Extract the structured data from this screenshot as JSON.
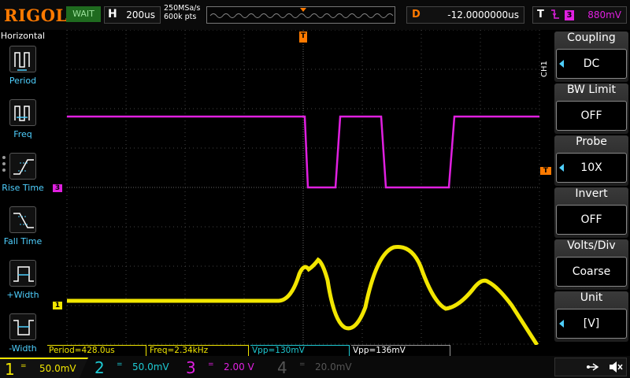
{
  "brand": "RIGOL",
  "status": "WAIT",
  "timebase": {
    "key": "H",
    "value": "200us"
  },
  "sample": {
    "rate": "250MSa/s",
    "points": "600k pts"
  },
  "delay": {
    "key": "D",
    "value": "-12.0000000us"
  },
  "trigger": {
    "key": "T",
    "edge_icon": "falling-edge-icon",
    "source": "3",
    "level": "880mV"
  },
  "left_menu": {
    "title": "Horizontal",
    "items": [
      {
        "label": "Period",
        "icon": "period-icon"
      },
      {
        "label": "Freq",
        "icon": "freq-icon"
      },
      {
        "label": "Rise Time",
        "icon": "rise-time-icon"
      },
      {
        "label": "Fall Time",
        "icon": "fall-time-icon"
      },
      {
        "label": "+Width",
        "icon": "pos-width-icon"
      },
      {
        "label": "-Width",
        "icon": "neg-width-icon"
      }
    ]
  },
  "right_menu": {
    "tab": "CH1",
    "items": [
      {
        "title": "Coupling",
        "value": "DC"
      },
      {
        "title": "BW Limit",
        "value": "OFF"
      },
      {
        "title": "Probe",
        "value": "10X"
      },
      {
        "title": "Invert",
        "value": "OFF"
      },
      {
        "title": "Volts/Div",
        "value": "Coarse"
      },
      {
        "title": "Unit",
        "value": "[V]"
      }
    ]
  },
  "measurements": [
    {
      "text": "Period=428.0us",
      "color": "#f2e600"
    },
    {
      "text": "Freq=2.34kHz",
      "color": "#f2e600"
    },
    {
      "text": "Vpp=130mV",
      "color": "#1ecad3"
    },
    {
      "text": "Vpp=136mV",
      "color": "#ffffff"
    }
  ],
  "channels": [
    {
      "num": "1",
      "coupling": "=",
      "scale": "50.0mV",
      "color": "#f2e600",
      "active": true
    },
    {
      "num": "2",
      "coupling": "=",
      "scale": "50.0mV",
      "color": "#1ecad3",
      "active": false
    },
    {
      "num": "3",
      "coupling": "=",
      "scale": "2.00 V",
      "color": "#e020e0",
      "active": false
    },
    {
      "num": "4",
      "coupling": "=",
      "scale": "20.0mV",
      "color": "#555555",
      "active": false
    }
  ],
  "markers": {
    "ch1": "1",
    "ch3": "3",
    "trigger": "T"
  },
  "colors": {
    "ch1": "#f2e600",
    "ch2": "#1ecad3",
    "ch3": "#e020e0",
    "accent": "#ff7a00"
  }
}
